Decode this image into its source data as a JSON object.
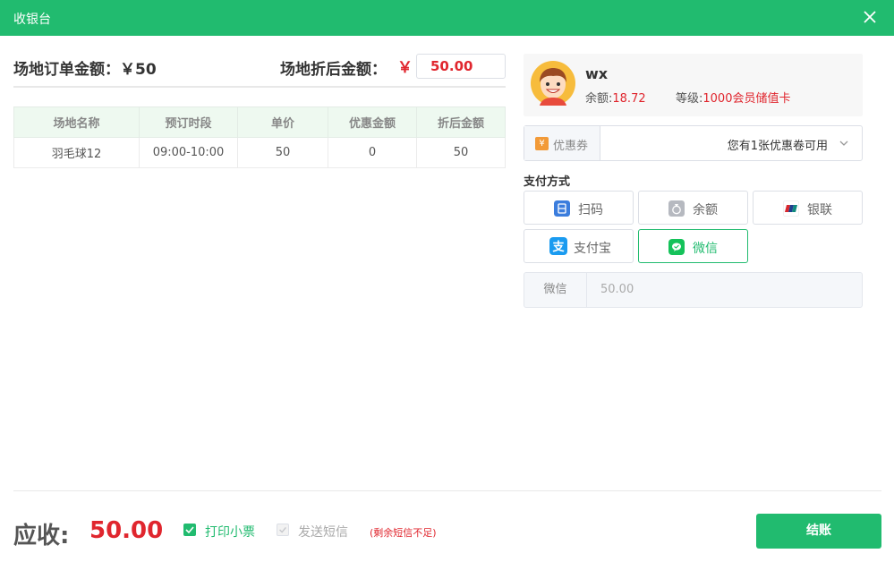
{
  "window": {
    "title": "收银台"
  },
  "summary": {
    "order_amount_label": "场地订单金额：",
    "order_amount_value": "￥50",
    "discount_label": "场地折后金额：",
    "currency_symbol": "￥",
    "discount_value": "50.00"
  },
  "table": {
    "headers": [
      "场地名称",
      "预订时段",
      "单价",
      "优惠金额",
      "折后金额"
    ],
    "rows": [
      [
        "羽毛球12",
        "09:00-10:00",
        "50",
        "0",
        "50"
      ]
    ]
  },
  "member": {
    "name": "wx",
    "balance_label": "余额:",
    "balance_value": "18.72",
    "level_label": "等级:",
    "level_value": "1000会员储值卡"
  },
  "coupon": {
    "label": "优惠券",
    "icon_glyph": "¥",
    "value": "您有1张优惠卷可用"
  },
  "payment": {
    "title": "支付方式",
    "methods": [
      {
        "label": "扫码",
        "icon": "qr-scan-icon",
        "color": "#3b7ddd"
      },
      {
        "label": "余额",
        "icon": "money-bag-icon",
        "color": "#b6b9c0"
      },
      {
        "label": "银联",
        "icon": "unionpay-icon",
        "color": "#d9262c"
      },
      {
        "label": "支付宝",
        "icon": "alipay-icon",
        "color": "#1a9bf0"
      },
      {
        "label": "微信",
        "icon": "wechat-icon",
        "color": "#15c25a"
      }
    ],
    "selected": "微信",
    "field_label": "微信",
    "field_value": "50.00"
  },
  "footer": {
    "due_label": "应收:",
    "due_value": "50.00",
    "print_receipt": "打印小票",
    "send_sms": "发送短信",
    "sms_note": "(剩余短信不足)",
    "settle_button": "结账"
  },
  "colors": {
    "brand": "#21bb6f",
    "price": "#e0262e"
  }
}
